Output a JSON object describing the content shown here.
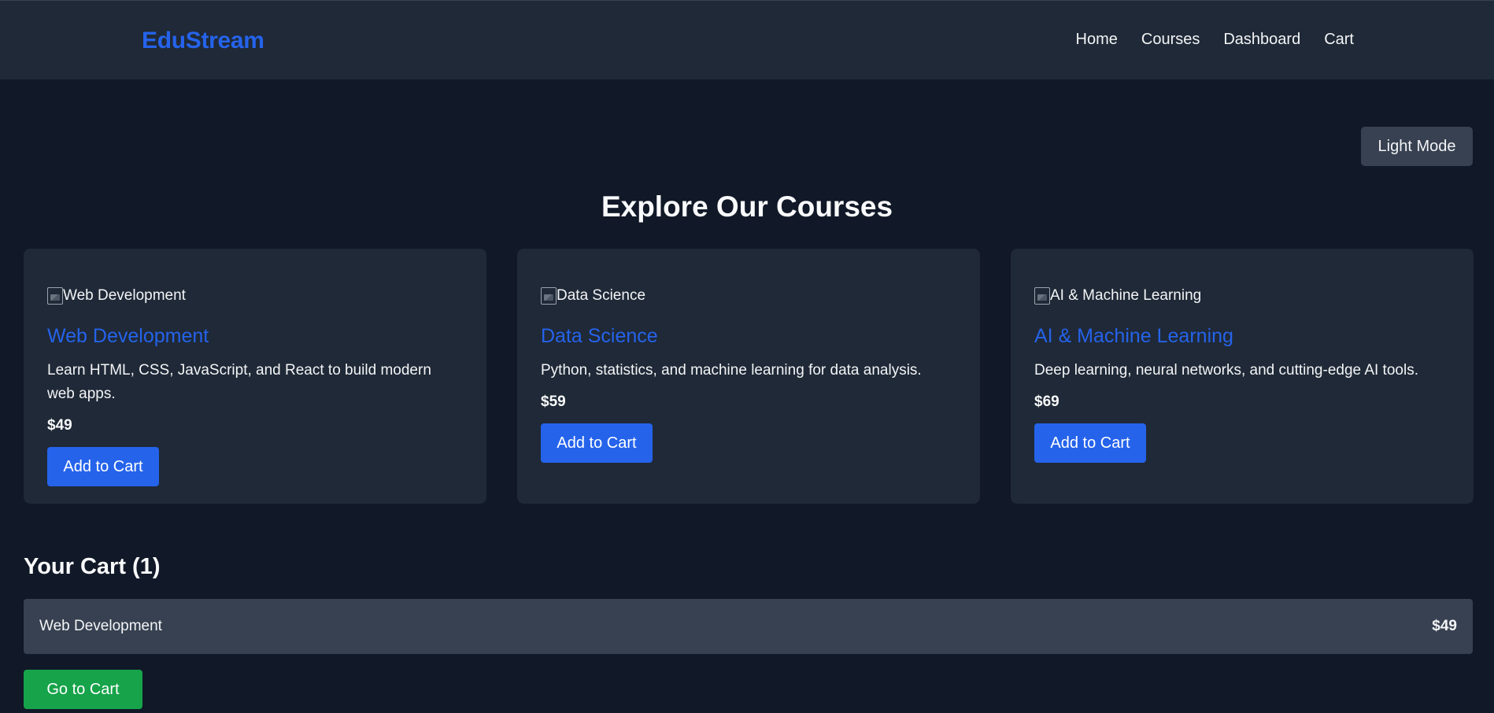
{
  "header": {
    "logo": "EduStream",
    "nav": [
      "Home",
      "Courses",
      "Dashboard",
      "Cart"
    ]
  },
  "theme_toggle_label": "Light Mode",
  "page_title": "Explore Our Courses",
  "courses": [
    {
      "image_alt": "Web Development",
      "title": "Web Development",
      "description": "Learn HTML, CSS, JavaScript, and React to build modern web apps.",
      "price": "$49",
      "button": "Add to Cart"
    },
    {
      "image_alt": "Data Science",
      "title": "Data Science",
      "description": "Python, statistics, and machine learning for data analysis.",
      "price": "$59",
      "button": "Add to Cart"
    },
    {
      "image_alt": "AI & Machine Learning",
      "title": "AI & Machine Learning",
      "description": "Deep learning, neural networks, and cutting-edge AI tools.",
      "price": "$69",
      "button": "Add to Cart"
    }
  ],
  "cart": {
    "title": "Your Cart (1)",
    "items": [
      {
        "name": "Web Development",
        "price": "$49"
      }
    ],
    "checkout_button": "Go to Cart"
  },
  "colors": {
    "background": "#111827",
    "surface": "#1f2937",
    "accent": "#2563eb",
    "success": "#16a34a"
  }
}
